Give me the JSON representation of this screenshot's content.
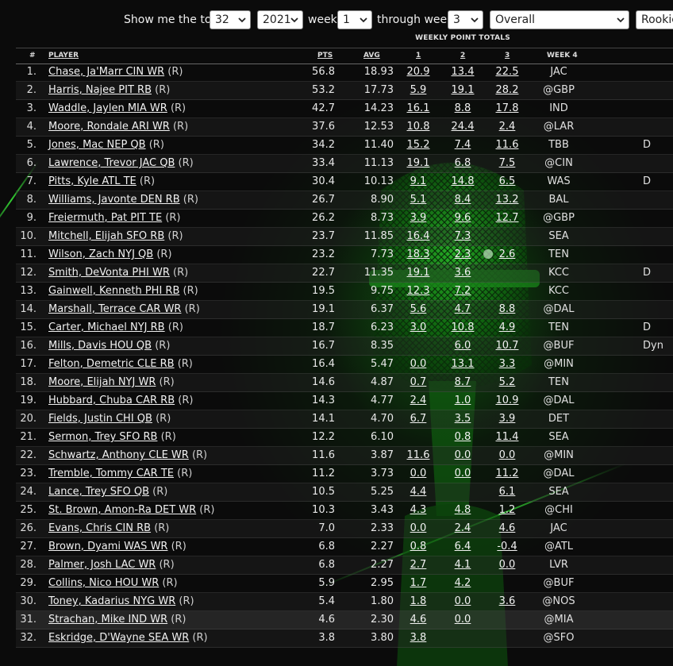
{
  "filters": {
    "show_label": "Show me the top",
    "top_value": "32",
    "season_value": "2021",
    "week_label": "week",
    "week_from": "1",
    "through_label": "through week",
    "week_to": "3",
    "category_value": "Overall",
    "rookie_value": "Rookie"
  },
  "table": {
    "group_header": "WEEKLY POINT TOTALS",
    "headers": {
      "rank": "#",
      "player": "PLAYER",
      "pts": "PTS",
      "avg": "AVG",
      "w1": "1",
      "w2": "2",
      "w3": "3",
      "w4": "WEEK 4"
    },
    "rows": [
      {
        "rank": "1.",
        "player": "Chase, Ja'Marr CIN WR",
        "tag": "(R)",
        "pts": "56.8",
        "avg": "18.93",
        "w1": "20.9",
        "w2": "13.4",
        "w3": "22.5",
        "opp": "JAC",
        "extra": ""
      },
      {
        "rank": "2.",
        "player": "Harris, Najee PIT RB",
        "tag": "(R)",
        "pts": "53.2",
        "avg": "17.73",
        "w1": "5.9",
        "w2": "19.1",
        "w3": "28.2",
        "opp": "@GBP",
        "extra": ""
      },
      {
        "rank": "3.",
        "player": "Waddle, Jaylen MIA WR",
        "tag": "(R)",
        "pts": "42.7",
        "avg": "14.23",
        "w1": "16.1",
        "w2": "8.8",
        "w3": "17.8",
        "opp": "IND",
        "extra": ""
      },
      {
        "rank": "4.",
        "player": "Moore, Rondale ARI WR",
        "tag": "(R)",
        "pts": "37.6",
        "avg": "12.53",
        "w1": "10.8",
        "w2": "24.4",
        "w3": "2.4",
        "opp": "@LAR",
        "extra": ""
      },
      {
        "rank": "5.",
        "player": "Jones, Mac NEP QB",
        "tag": "(R)",
        "pts": "34.2",
        "avg": "11.40",
        "w1": "15.2",
        "w2": "7.4",
        "w3": "11.6",
        "opp": "TBB",
        "extra": "D"
      },
      {
        "rank": "6.",
        "player": "Lawrence, Trevor JAC QB",
        "tag": "(R)",
        "pts": "33.4",
        "avg": "11.13",
        "w1": "19.1",
        "w2": "6.8",
        "w3": "7.5",
        "opp": "@CIN",
        "extra": ""
      },
      {
        "rank": "7.",
        "player": "Pitts, Kyle ATL TE",
        "tag": "(R)",
        "pts": "30.4",
        "avg": "10.13",
        "w1": "9.1",
        "w2": "14.8",
        "w3": "6.5",
        "opp": "WAS",
        "extra": "D"
      },
      {
        "rank": "8.",
        "player": "Williams, Javonte DEN RB",
        "tag": "(R)",
        "pts": "26.7",
        "avg": "8.90",
        "w1": "5.1",
        "w2": "8.4",
        "w3": "13.2",
        "opp": "BAL",
        "extra": ""
      },
      {
        "rank": "9.",
        "player": "Freiermuth, Pat PIT TE",
        "tag": "(R)",
        "pts": "26.2",
        "avg": "8.73",
        "w1": "3.9",
        "w2": "9.6",
        "w3": "12.7",
        "opp": "@GBP",
        "extra": ""
      },
      {
        "rank": "10.",
        "player": "Mitchell, Elijah SFO RB",
        "tag": "(R)",
        "pts": "23.7",
        "avg": "11.85",
        "w1": "16.4",
        "w2": "7.3",
        "w3": "",
        "opp": "SEA",
        "extra": ""
      },
      {
        "rank": "11.",
        "player": "Wilson, Zach NYJ QB",
        "tag": "(R)",
        "pts": "23.2",
        "avg": "7.73",
        "w1": "18.3",
        "w2": "2.3",
        "w3": "2.6",
        "opp": "TEN",
        "extra": ""
      },
      {
        "rank": "12.",
        "player": "Smith, DeVonta PHI WR",
        "tag": "(R)",
        "pts": "22.7",
        "avg": "11.35",
        "w1": "19.1",
        "w2": "3.6",
        "w3": "",
        "opp": "KCC",
        "extra": "D"
      },
      {
        "rank": "13.",
        "player": "Gainwell, Kenneth PHI RB",
        "tag": "(R)",
        "pts": "19.5",
        "avg": "9.75",
        "w1": "12.3",
        "w2": "7.2",
        "w3": "",
        "opp": "KCC",
        "extra": ""
      },
      {
        "rank": "14.",
        "player": "Marshall, Terrace CAR WR",
        "tag": "(R)",
        "pts": "19.1",
        "avg": "6.37",
        "w1": "5.6",
        "w2": "4.7",
        "w3": "8.8",
        "opp": "@DAL",
        "extra": ""
      },
      {
        "rank": "15.",
        "player": "Carter, Michael NYJ RB",
        "tag": "(R)",
        "pts": "18.7",
        "avg": "6.23",
        "w1": "3.0",
        "w2": "10.8",
        "w3": "4.9",
        "opp": "TEN",
        "extra": "D"
      },
      {
        "rank": "16.",
        "player": "Mills, Davis HOU QB",
        "tag": "(R)",
        "pts": "16.7",
        "avg": "8.35",
        "w1": "",
        "w2": "6.0",
        "w3": "10.7",
        "opp": "@BUF",
        "extra": "Dyn"
      },
      {
        "rank": "17.",
        "player": "Felton, Demetric CLE RB",
        "tag": "(R)",
        "pts": "16.4",
        "avg": "5.47",
        "w1": "0.0",
        "w2": "13.1",
        "w3": "3.3",
        "opp": "@MIN",
        "extra": ""
      },
      {
        "rank": "18.",
        "player": "Moore, Elijah NYJ WR",
        "tag": "(R)",
        "pts": "14.6",
        "avg": "4.87",
        "w1": "0.7",
        "w2": "8.7",
        "w3": "5.2",
        "opp": "TEN",
        "extra": ""
      },
      {
        "rank": "19.",
        "player": "Hubbard, Chuba CAR RB",
        "tag": "(R)",
        "pts": "14.3",
        "avg": "4.77",
        "w1": "2.4",
        "w2": "1.0",
        "w3": "10.9",
        "opp": "@DAL",
        "extra": ""
      },
      {
        "rank": "20.",
        "player": "Fields, Justin CHI QB",
        "tag": "(R)",
        "pts": "14.1",
        "avg": "4.70",
        "w1": "6.7",
        "w2": "3.5",
        "w3": "3.9",
        "opp": "DET",
        "extra": ""
      },
      {
        "rank": "21.",
        "player": "Sermon, Trey SFO RB",
        "tag": "(R)",
        "pts": "12.2",
        "avg": "6.10",
        "w1": "",
        "w2": "0.8",
        "w3": "11.4",
        "opp": "SEA",
        "extra": ""
      },
      {
        "rank": "22.",
        "player": "Schwartz, Anthony CLE WR",
        "tag": "(R)",
        "pts": "11.6",
        "avg": "3.87",
        "w1": "11.6",
        "w2": "0.0",
        "w3": "0.0",
        "opp": "@MIN",
        "extra": ""
      },
      {
        "rank": "23.",
        "player": "Tremble, Tommy CAR TE",
        "tag": "(R)",
        "pts": "11.2",
        "avg": "3.73",
        "w1": "0.0",
        "w2": "0.0",
        "w3": "11.2",
        "opp": "@DAL",
        "extra": ""
      },
      {
        "rank": "24.",
        "player": "Lance, Trey SFO QB",
        "tag": "(R)",
        "pts": "10.5",
        "avg": "5.25",
        "w1": "4.4",
        "w2": "",
        "w3": "6.1",
        "opp": "SEA",
        "extra": ""
      },
      {
        "rank": "25.",
        "player": "St. Brown, Amon-Ra DET WR",
        "tag": "(R)",
        "pts": "10.3",
        "avg": "3.43",
        "w1": "4.3",
        "w2": "4.8",
        "w3": "1.2",
        "opp": "@CHI",
        "extra": ""
      },
      {
        "rank": "26.",
        "player": "Evans, Chris CIN RB",
        "tag": "(R)",
        "pts": "7.0",
        "avg": "2.33",
        "w1": "0.0",
        "w2": "2.4",
        "w3": "4.6",
        "opp": "JAC",
        "extra": ""
      },
      {
        "rank": "27.",
        "player": "Brown, Dyami WAS WR",
        "tag": "(R)",
        "pts": "6.8",
        "avg": "2.27",
        "w1": "0.8",
        "w2": "6.4",
        "w3": "-0.4",
        "opp": "@ATL",
        "extra": ""
      },
      {
        "rank": "28.",
        "player": "Palmer, Josh LAC WR",
        "tag": "(R)",
        "pts": "6.8",
        "avg": "2.27",
        "w1": "2.7",
        "w2": "4.1",
        "w3": "0.0",
        "opp": "LVR",
        "extra": ""
      },
      {
        "rank": "29.",
        "player": "Collins, Nico HOU WR",
        "tag": "(R)",
        "pts": "5.9",
        "avg": "2.95",
        "w1": "1.7",
        "w2": "4.2",
        "w3": "",
        "opp": "@BUF",
        "extra": ""
      },
      {
        "rank": "30.",
        "player": "Toney, Kadarius NYG WR",
        "tag": "(R)",
        "pts": "5.4",
        "avg": "1.80",
        "w1": "1.8",
        "w2": "0.0",
        "w3": "3.6",
        "opp": "@NOS",
        "extra": ""
      },
      {
        "rank": "31.",
        "player": "Strachan, Mike IND WR",
        "tag": "(R)",
        "pts": "4.6",
        "avg": "2.30",
        "w1": "4.6",
        "w2": "0.0",
        "w3": "",
        "opp": "@MIA",
        "extra": ""
      },
      {
        "rank": "32.",
        "player": "Eskridge, D'Wayne SEA WR",
        "tag": "(R)",
        "pts": "3.8",
        "avg": "3.80",
        "w1": "3.8",
        "w2": "",
        "w3": "",
        "opp": "@SFO",
        "extra": ""
      }
    ]
  }
}
